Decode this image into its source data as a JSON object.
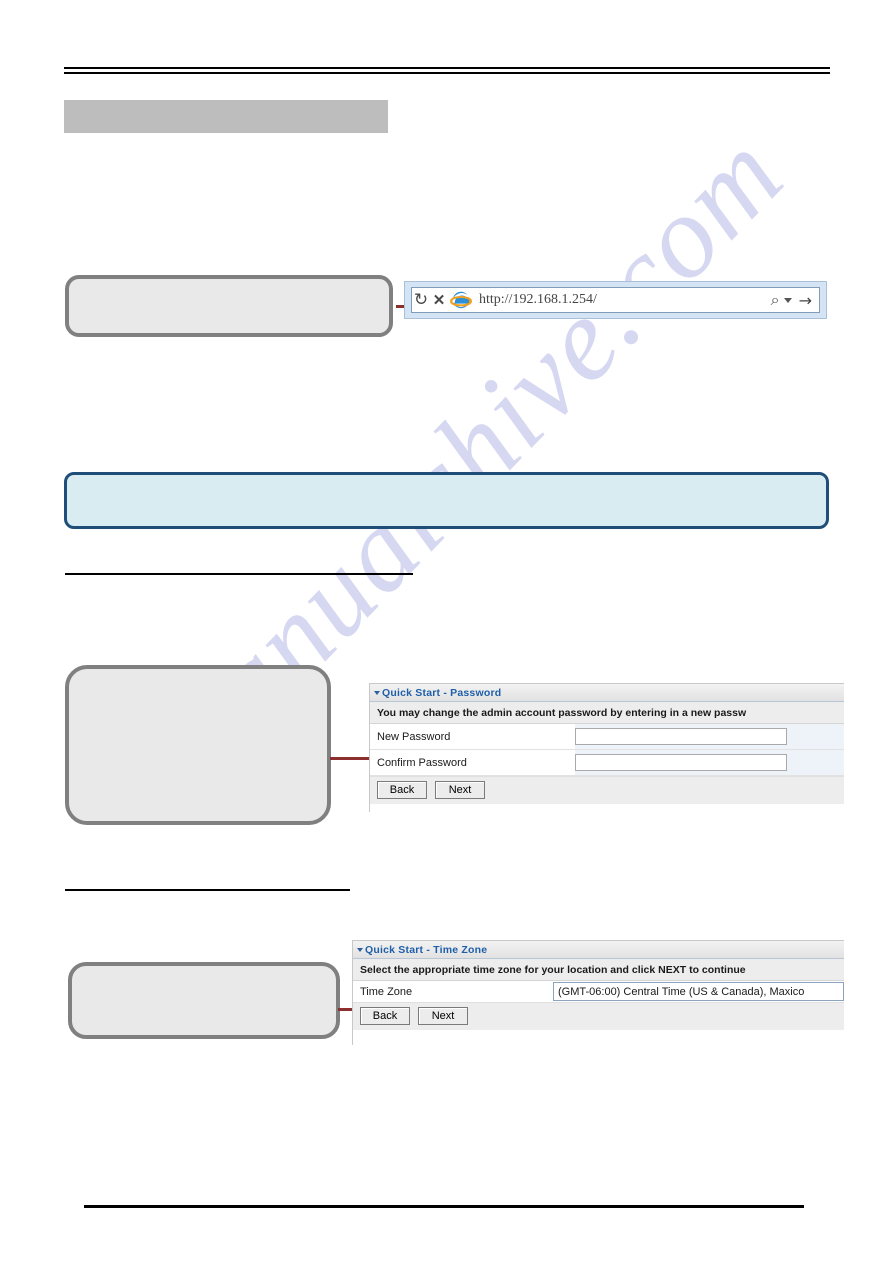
{
  "page": {
    "watermark_text": "manualshive.com",
    "title_banner_text": "",
    "note_box_text": ""
  },
  "browser": {
    "url": "http://192.168.1.254/",
    "icons": {
      "refresh": "refresh-icon",
      "stop": "stop-icon",
      "brand": "internet-explorer-icon",
      "search": "search-icon",
      "dropdown": "chevron-down-icon",
      "go": "go-arrow-icon"
    },
    "refresh_glyph": "↻",
    "stop_glyph": "✕",
    "search_glyph": "⌕",
    "go_glyph": "→"
  },
  "password_panel": {
    "title": "Quick Start - Password",
    "description": "You may change the admin account password by entering in a new passw",
    "rows": [
      {
        "label": "New Password",
        "value": ""
      },
      {
        "label": "Confirm Password",
        "value": ""
      }
    ],
    "buttons": {
      "back": "Back",
      "next": "Next"
    }
  },
  "timezone_panel": {
    "title": "Quick Start - Time Zone",
    "description": "Select the appropriate time zone for your location and click NEXT to continue",
    "row": {
      "label": "Time Zone",
      "value": "(GMT-06:00) Central Time (US & Canada), Maxico"
    },
    "buttons": {
      "back": "Back",
      "next": "Next"
    }
  },
  "colors": {
    "panel_title": "#1f5fa9",
    "note_border": "#1f4e79",
    "note_fill": "#d9ecf2",
    "callout_border": "#808080",
    "callout_fill": "#e9e9e9",
    "leader_line": "#8c2f2f",
    "banner_gray": "#bdbdbd"
  }
}
